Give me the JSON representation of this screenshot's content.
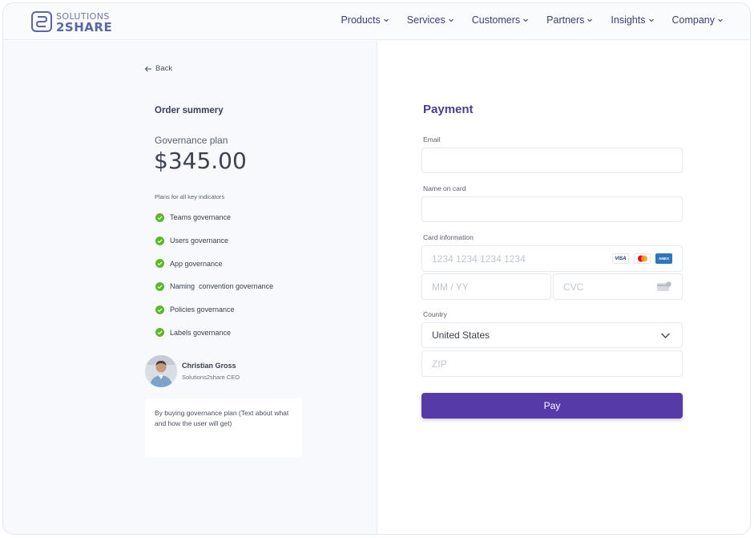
{
  "brand": {
    "line1": "SOLUTIONS",
    "line2": "2SHARE"
  },
  "nav": [
    {
      "label": "Products"
    },
    {
      "label": "Services"
    },
    {
      "label": "Customers"
    },
    {
      "label": "Partners"
    },
    {
      "label": "Insights"
    },
    {
      "label": "Company"
    }
  ],
  "summary": {
    "back_label": "Back",
    "title": "Order summery",
    "plan_name": "Governance plan",
    "price": "$345.00",
    "plans_label": "Plans for all key indicators",
    "features": [
      "Teams governance",
      "Users governance",
      "App governance",
      "Naming  convention governance",
      "Policies governance",
      "Labels governance"
    ],
    "person_name": "Christian Gross",
    "person_role": "Solutions2share CEO",
    "note": "By buying governance plan (Text about what and how the user will get)"
  },
  "payment": {
    "title": "Payment",
    "email_label": "Email",
    "name_label": "Name on card",
    "card_label": "Card information",
    "card_placeholder": "1234 1234 1234 1234",
    "expiry_placeholder": "MM / YY",
    "cvc_placeholder": "CVC",
    "card_brands": [
      "VISA",
      "Mastercard",
      "AMEX"
    ],
    "country_label": "Country",
    "country_value": "United States",
    "zip_placeholder": "ZIP",
    "pay_label": "Pay"
  },
  "colors": {
    "accent": "#553aa8",
    "title": "#4b3f8c",
    "check": "#5cb82a"
  }
}
